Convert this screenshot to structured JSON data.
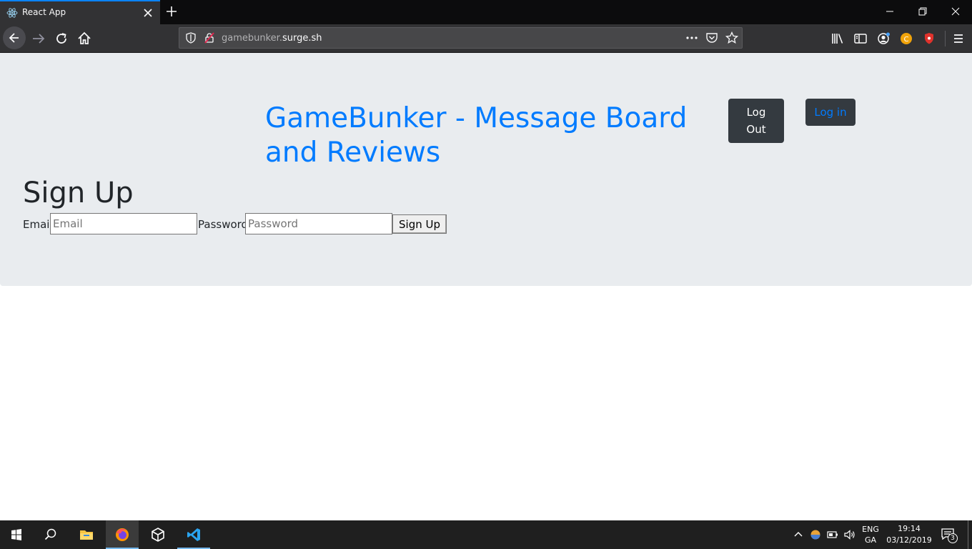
{
  "browser": {
    "tab": {
      "title": "React App",
      "favicon": "react-icon"
    },
    "url": {
      "prefix": "gamebunker.",
      "host": "surge.sh"
    },
    "icons": [
      "back-icon",
      "forward-icon",
      "reload-icon",
      "home-icon",
      "shield-icon",
      "site-info-icon",
      "more-icon",
      "pocket-icon",
      "bookmark-star-icon",
      "library-icon",
      "sidebar-icon",
      "account-icon",
      "extension-c-icon",
      "extension-shield-icon",
      "menu-icon"
    ]
  },
  "page": {
    "site_title": "GameBunker - Message Board and Reviews",
    "logout_label": "Log Out",
    "login_label": "Log in",
    "signup_heading": "Sign Up",
    "form": {
      "email_label": "Email",
      "email_placeholder": "Email",
      "password_label": "Password",
      "password_placeholder": "Password",
      "submit_label": "Sign Up"
    }
  },
  "colors": {
    "link_blue": "#007bff",
    "dark_button": "#343a40",
    "jumbotron_bg": "#e9ecef"
  },
  "taskbar": {
    "apps": [
      "start-icon",
      "search-icon",
      "file-explorer-icon",
      "firefox-icon",
      "unity-icon",
      "vscode-icon"
    ],
    "tray": {
      "lang_line1": "ENG",
      "lang_line2": "GA",
      "time": "19:14",
      "date": "03/12/2019",
      "notification_count": "3"
    }
  }
}
